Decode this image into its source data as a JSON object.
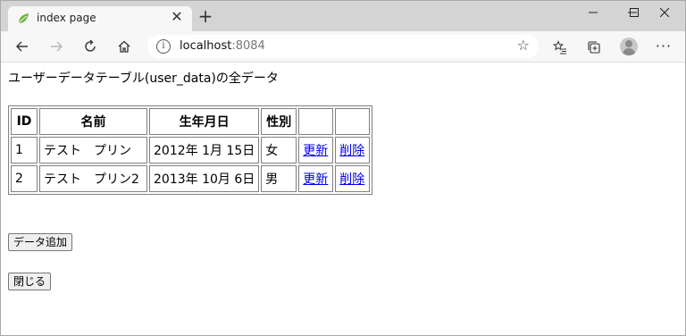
{
  "browser": {
    "tab_title": "index page",
    "tab_close": "✕",
    "new_tab": "+",
    "url_host": "localhost",
    "url_port": ":8084",
    "icons": {
      "back": "arrow-left-icon",
      "forward": "arrow-right-icon",
      "refresh": "refresh-icon",
      "home": "home-icon",
      "info": "info-icon",
      "favorite": "star-icon",
      "favorites_list": "favorites-icon",
      "collections": "collections-icon",
      "profile": "avatar",
      "menu": "more-icon"
    }
  },
  "page": {
    "heading": "ユーザーデータテーブル(user_data)の全データ",
    "table": {
      "headers": [
        "ID",
        "名前",
        "生年月日",
        "性別",
        "",
        ""
      ],
      "rows": [
        {
          "id": "1",
          "name": "テスト　プリン",
          "birthday": "2012年 1月 15日",
          "gender": "女",
          "update": "更新",
          "delete": "削除"
        },
        {
          "id": "2",
          "name": "テスト　プリン2",
          "birthday": "2013年 10月 6日",
          "gender": "男",
          "update": "更新",
          "delete": "削除"
        }
      ]
    },
    "add_button": "データ追加",
    "close_button": "閉じる"
  }
}
